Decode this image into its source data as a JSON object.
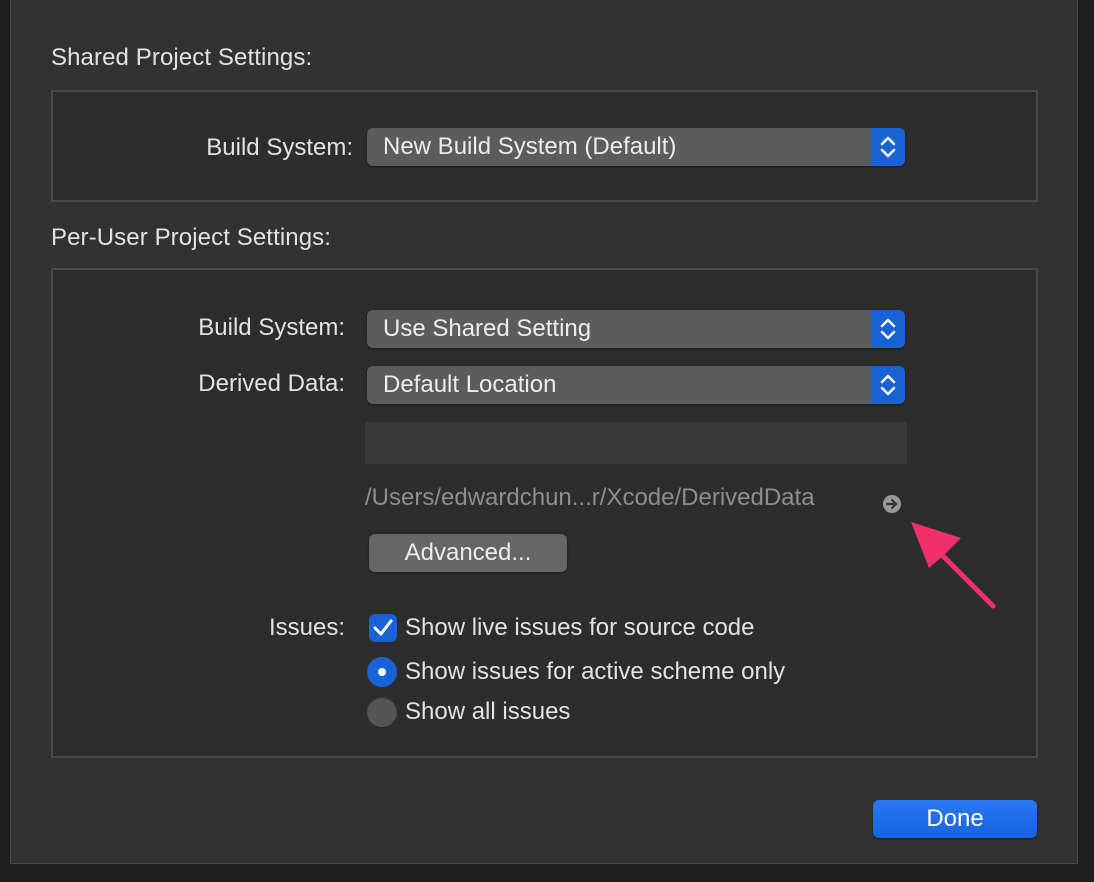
{
  "shared": {
    "title": "Shared Project Settings:",
    "build_system_label": "Build System:",
    "build_system_value": "New Build System (Default)"
  },
  "per_user": {
    "title": "Per-User Project Settings:",
    "build_system_label": "Build System:",
    "build_system_value": "Use Shared Setting",
    "derived_data_label": "Derived Data:",
    "derived_data_value": "Default Location",
    "custom_path_value": "",
    "derived_data_path": "/Users/edwardchun...r/Xcode/DerivedData",
    "advanced_button": "Advanced...",
    "issues_label": "Issues:",
    "issues": {
      "live_issues": {
        "label": "Show live issues for source code",
        "checked": true
      },
      "scope_options": [
        {
          "label": "Show issues for active scheme only",
          "selected": true
        },
        {
          "label": "Show all issues",
          "selected": false
        }
      ]
    }
  },
  "footer": {
    "done_button": "Done"
  },
  "icons": {
    "popup_stepper": "up-down-chevron-icon",
    "reveal": "arrow-circle-right-icon",
    "annotation": "pink-arrow-pointer"
  },
  "colors": {
    "accent": "#1a63d6",
    "annotation": "#f0306a"
  }
}
